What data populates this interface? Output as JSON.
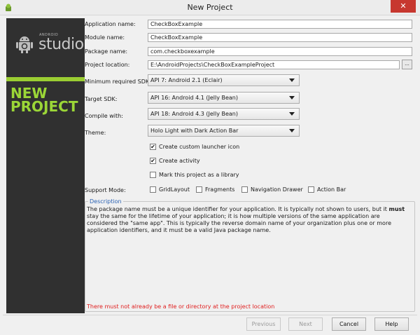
{
  "window": {
    "title": "New Project",
    "close_symbol": "✕"
  },
  "sidebar": {
    "logo_small": "ANDROID",
    "logo_word": "studio",
    "heading": "NEW PROJECT"
  },
  "form": {
    "application_name_label": "Application name:",
    "application_name_value": "CheckBoxExample",
    "module_name_label": "Module name:",
    "module_name_value": "CheckBoxExample",
    "package_name_label": "Package name:",
    "package_name_value": "com.checkboxexample",
    "project_location_label": "Project location:",
    "project_location_value": "E:\\AndroidProjects\\CheckBoxExampleProject",
    "browse_label": "...",
    "min_sdk_label": "Minimum required SDK:",
    "min_sdk_value": "API 7: Android 2.1 (Eclair)",
    "target_sdk_label": "Target SDK:",
    "target_sdk_value": "API 16: Android 4.1 (Jelly Bean)",
    "compile_with_label": "Compile with:",
    "compile_with_value": "API 18: Android 4.3 (Jelly Bean)",
    "theme_label": "Theme:",
    "theme_value": "Holo Light with Dark Action Bar"
  },
  "options": {
    "create_launcher_icon": {
      "label": "Create custom launcher icon",
      "checked": true
    },
    "create_activity": {
      "label": "Create activity",
      "checked": true
    },
    "mark_library": {
      "label": "Mark this project as a library",
      "checked": false
    }
  },
  "support_mode": {
    "label": "Support Mode:",
    "gridlayout": "GridLayout",
    "fragments": "Fragments",
    "navigation_drawer": "Navigation Drawer",
    "action_bar": "Action Bar"
  },
  "description": {
    "legend": "Description",
    "text_part1": "The package name must be a unique identifier for your application. It is typically not shown to users, but it ",
    "text_bold": "must",
    "text_part2": " stay the same for the lifetime of your application; it is how multiple versions of the same application are considered the \"same app\". This is typically the reverse domain name of your organization plus one or more application identifiers, and it must be a valid Java package name."
  },
  "error": "There must not already be a file or directory at the project location",
  "buttons": {
    "previous": "Previous",
    "next": "Next",
    "cancel": "Cancel",
    "help": "Help"
  },
  "colors": {
    "sidebar_bg": "#303030",
    "accent_green": "#9bd637",
    "close_red": "#c7372f",
    "error_red": "#e02020"
  }
}
